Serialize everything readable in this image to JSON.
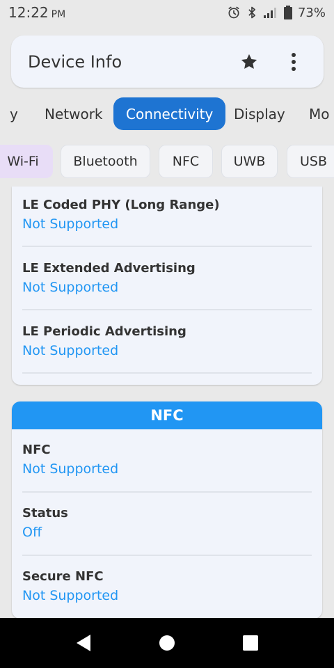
{
  "status_bar": {
    "time": "12:22",
    "ampm": "PM",
    "battery": "73%",
    "icons": [
      "alarm-icon",
      "bluetooth-icon",
      "signal-icon",
      "battery-icon"
    ]
  },
  "app_bar": {
    "title": "Device Info",
    "favorite_icon": "star-icon",
    "menu_icon": "more-vert-icon"
  },
  "tabs": {
    "items": [
      "y",
      "Network",
      "Connectivity",
      "Display",
      "Mo"
    ],
    "active": "Connectivity"
  },
  "chips": {
    "items": [
      "Wi-Fi",
      "Bluetooth",
      "NFC",
      "UWB",
      "USB"
    ],
    "selected": "Wi-Fi"
  },
  "bluetooth_card": {
    "items": [
      {
        "label": "LE Coded PHY (Long Range)",
        "value": "Not Supported"
      },
      {
        "label": "LE Extended Advertising",
        "value": "Not Supported"
      },
      {
        "label": "LE Periodic Advertising",
        "value": "Not Supported"
      }
    ]
  },
  "nfc_card": {
    "title": "NFC",
    "items": [
      {
        "label": "NFC",
        "value": "Not Supported"
      },
      {
        "label": "Status",
        "value": "Off"
      },
      {
        "label": "Secure NFC",
        "value": "Not Supported"
      }
    ]
  },
  "nav_bar": {
    "icons": [
      "back-icon",
      "home-icon",
      "recents-icon"
    ]
  },
  "colors": {
    "accent": "#2196f3",
    "active_tab": "#1e74d2",
    "selected_chip": "#e8ddf7"
  }
}
